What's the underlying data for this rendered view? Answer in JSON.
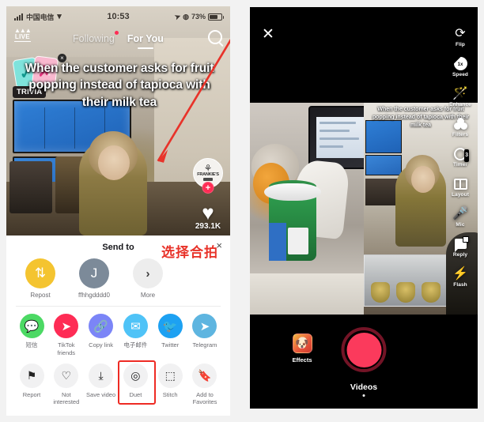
{
  "left_phone": {
    "status_bar": {
      "carrier": "中国电信",
      "time": "10:53",
      "battery": "73%",
      "signal_icon": "cellular-signal-icon",
      "wifi_icon": "wifi-icon",
      "location_icon": "location-arrow-icon"
    },
    "top_nav": {
      "live_label": "LIVE",
      "following_label": "Following",
      "for_you_label": "For You",
      "search_icon": "search-icon"
    },
    "video": {
      "trivia_label": "TRIVIA",
      "card_check": "✓",
      "card_x": "✗",
      "card_close": "×",
      "caption": "When the customer asks for fruit popping instead of tapioca with their milk tea",
      "avatar_name": "FRANKIE'S",
      "follow_plus": "+",
      "heart_icon": "heart-icon",
      "like_count": "293.1K"
    },
    "share_sheet": {
      "title": "Send to",
      "close": "×",
      "send_to": [
        {
          "label": "Repost",
          "icon": "repost-icon",
          "glyph": "⇅"
        },
        {
          "label": "ffhhgdddd0",
          "icon": "user-avatar-icon",
          "glyph": "J"
        },
        {
          "label": "More",
          "icon": "chevron-right-icon",
          "glyph": "›"
        }
      ],
      "share_targets": [
        {
          "label": "短信",
          "icon": "sms-icon",
          "glyph": "💬"
        },
        {
          "label": "TikTok friends",
          "icon": "tiktok-friends-icon",
          "glyph": "➤"
        },
        {
          "label": "Copy link",
          "icon": "link-icon",
          "glyph": "🔗"
        },
        {
          "label": "电子邮件",
          "icon": "email-icon",
          "glyph": "✉"
        },
        {
          "label": "Twitter",
          "icon": "twitter-icon",
          "glyph": "🐦"
        },
        {
          "label": "Telegram",
          "icon": "telegram-icon",
          "glyph": "➤"
        }
      ],
      "actions": [
        {
          "label": "Report",
          "icon": "flag-icon",
          "glyph": "⚑",
          "highlighted": false
        },
        {
          "label": "Not interested",
          "icon": "broken-heart-icon",
          "glyph": "♡",
          "highlighted": false
        },
        {
          "label": "Save video",
          "icon": "download-icon",
          "glyph": "⤓",
          "highlighted": false
        },
        {
          "label": "Duet",
          "icon": "duet-icon",
          "glyph": "◎",
          "highlighted": true
        },
        {
          "label": "Stitch",
          "icon": "stitch-icon",
          "glyph": "⬚",
          "highlighted": false
        },
        {
          "label": "Add to Favorites",
          "icon": "bookmark-icon",
          "glyph": "🔖",
          "highlighted": false
        }
      ]
    },
    "annotation": {
      "text": "选择合拍",
      "color": "#e8332a",
      "close": "×",
      "arrow_icon": "red-arrow-icon"
    }
  },
  "right_phone": {
    "close_icon": "close-icon",
    "close_glyph": "✕",
    "rail": [
      {
        "label": "Flip",
        "icon": "flip-camera-icon",
        "glyph": "⟳"
      },
      {
        "label": "Speed",
        "icon": "speed-icon",
        "value": "1x"
      },
      {
        "label": "Enhance",
        "icon": "enhance-wand-icon",
        "glyph": "✨"
      },
      {
        "label": "Filters",
        "icon": "filters-icon"
      },
      {
        "label": "Timer",
        "icon": "timer-icon",
        "value": "3"
      },
      {
        "label": "Layout",
        "icon": "layout-icon"
      },
      {
        "label": "Mic",
        "icon": "mic-muted-icon",
        "glyph": "🎤"
      },
      {
        "label": "Reply",
        "icon": "reply-icon"
      },
      {
        "label": "Flash",
        "icon": "flash-off-icon",
        "glyph": "⚡"
      }
    ],
    "duet": {
      "left_pane_name": "camera-preview",
      "right_pane_name": "original-video",
      "original_caption": "When the customer asks for fruit popping instead of tapioca with their milk tea"
    },
    "bottom": {
      "effects_label": "Effects",
      "effects_icon": "effects-icon",
      "record_icon": "record-button",
      "mode_label": "Videos",
      "mode_dot": "page-indicator-dot"
    }
  },
  "colors": {
    "tiktok_red": "#fe2c55",
    "annotation_red": "#e8332a",
    "repost_yellow": "#f4c430",
    "record_red": "#fb3a5c"
  }
}
